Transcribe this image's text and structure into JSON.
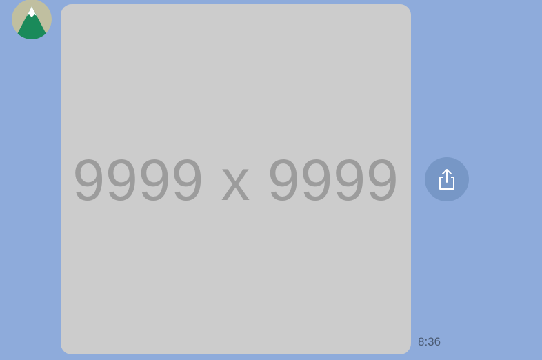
{
  "message": {
    "avatar_icon": "mountain-avatar-icon",
    "image_placeholder_label": "9999 x 9999",
    "share_icon": "share-icon",
    "timestamp": "8:36"
  },
  "colors": {
    "background": "#8eabdb",
    "image_placeholder": "#cccccc",
    "placeholder_text": "#9c9c9c",
    "share_button": "#7797c6",
    "avatar_bg": "#c0bfa0",
    "avatar_mountain": "#1a8a5a"
  }
}
